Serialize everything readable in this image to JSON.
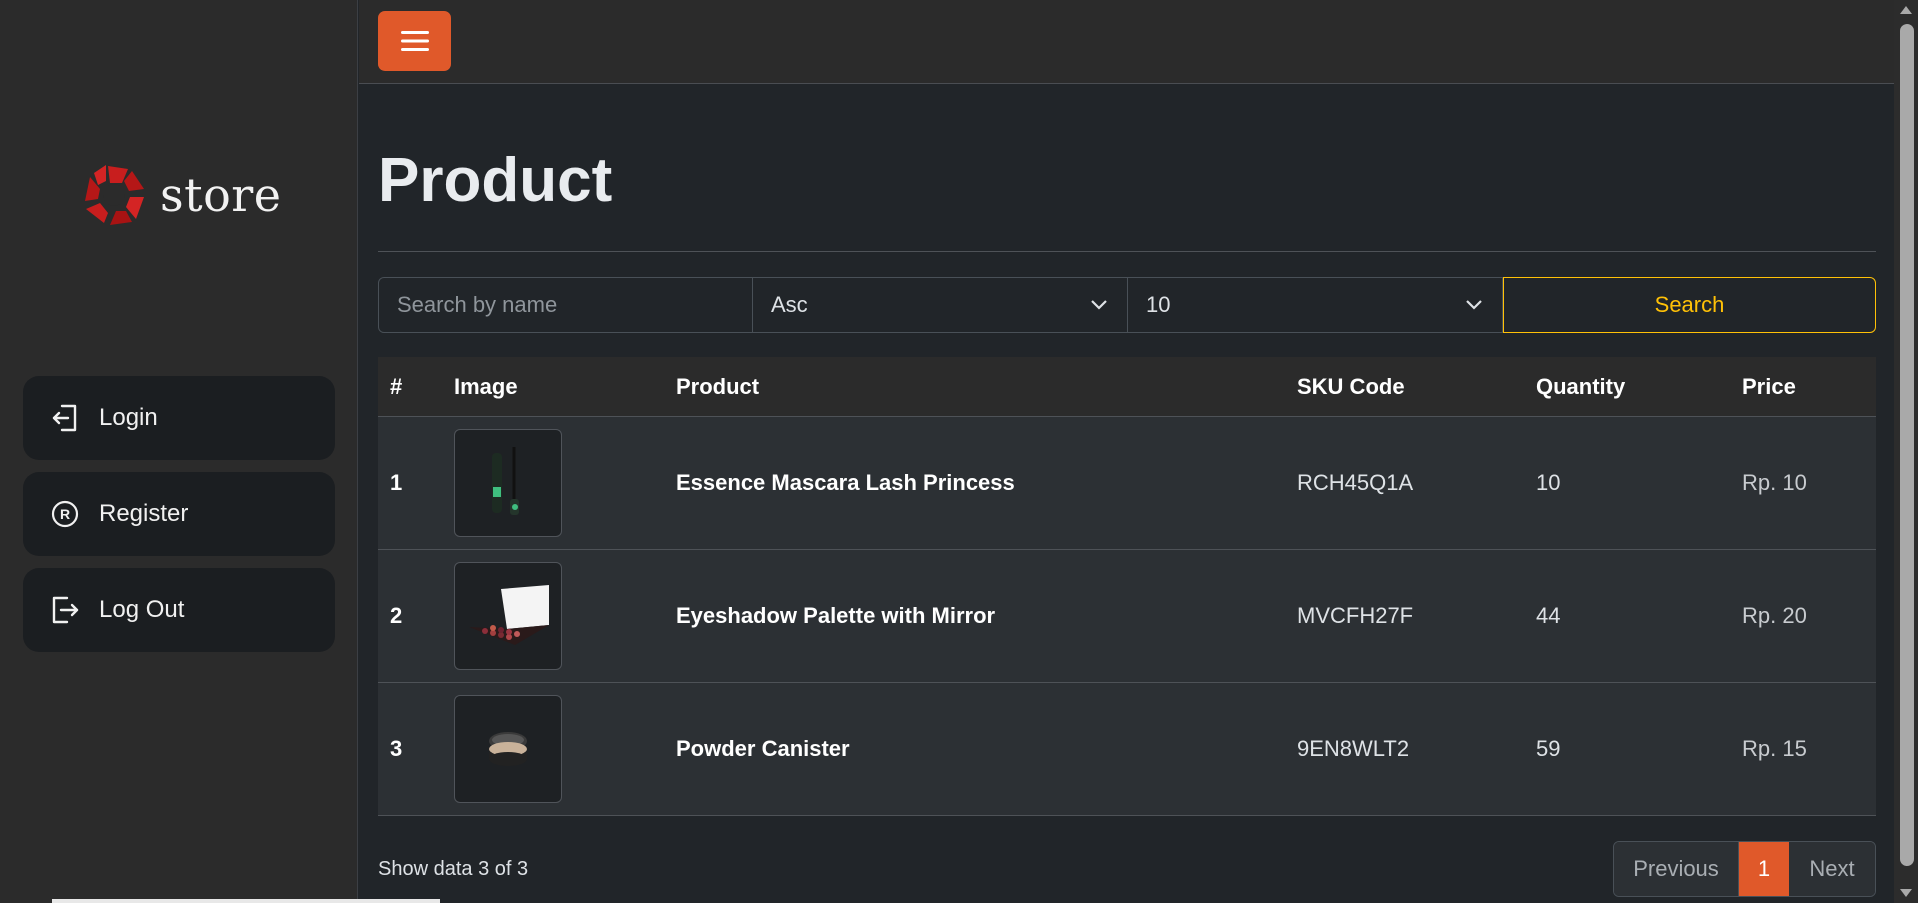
{
  "sidebar": {
    "logo_text": "store",
    "items": [
      {
        "label": "Login",
        "icon": "login-icon"
      },
      {
        "label": "Register",
        "icon": "registered-icon"
      },
      {
        "label": "Log Out",
        "icon": "logout-icon"
      }
    ]
  },
  "topbar": {
    "menu_icon": "hamburger-icon"
  },
  "main": {
    "title": "Product",
    "search": {
      "placeholder": "Search by name",
      "order_value": "Asc",
      "limit_value": "10",
      "button_label": "Search"
    },
    "table": {
      "headers": {
        "num": "#",
        "image": "Image",
        "product": "Product",
        "sku": "SKU Code",
        "qty": "Quantity",
        "price": "Price"
      },
      "rows": [
        {
          "num": "1",
          "image": "mascara-image",
          "product": "Essence Mascara Lash Princess",
          "sku": "RCH45Q1A",
          "qty": "10",
          "price": "Rp. 10"
        },
        {
          "num": "2",
          "image": "eyeshadow-palette-image",
          "product": "Eyeshadow Palette with Mirror",
          "sku": "MVCFH27F",
          "qty": "44",
          "price": "Rp. 20"
        },
        {
          "num": "3",
          "image": "powder-canister-image",
          "product": "Powder Canister",
          "sku": "9EN8WLT2",
          "qty": "59",
          "price": "Rp. 15"
        }
      ]
    },
    "footer_text": "Show data 3 of 3",
    "pagination": {
      "prev": "Previous",
      "current": "1",
      "next": "Next"
    }
  },
  "colors": {
    "accent": "#e0592a",
    "search_button": "#ffc107",
    "background": "#212529"
  }
}
